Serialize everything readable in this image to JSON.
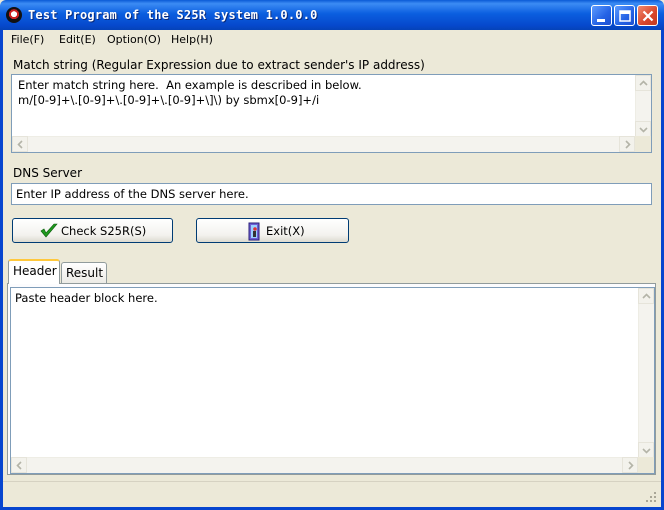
{
  "window": {
    "title": "Test Program of the S25R system  1.0.0.0"
  },
  "menu": {
    "file": "File(F)",
    "edit": "Edit(E)",
    "option": "Option(O)",
    "help": "Help(H)"
  },
  "match": {
    "label": "Match string (Regular Expression due to extract sender's IP address)",
    "text": "Enter match string here.  An example is described in below.\nm/[0-9]+\\.[0-9]+\\.[0-9]+\\.[0-9]+\\]\\) by sbmx[0-9]+/i"
  },
  "dns": {
    "label": "DNS Server",
    "value": "Enter IP address of the DNS server here."
  },
  "buttons": {
    "check": "Check S25R(S)",
    "exit": "Exit(X)"
  },
  "tabs": [
    {
      "label": "Header",
      "active": true
    },
    {
      "label": "Result",
      "active": false
    }
  ],
  "header_box": {
    "text": "Paste header block here."
  },
  "colors": {
    "titlebar": "#0b5fe0",
    "check_icon": "#1f9a1f"
  }
}
